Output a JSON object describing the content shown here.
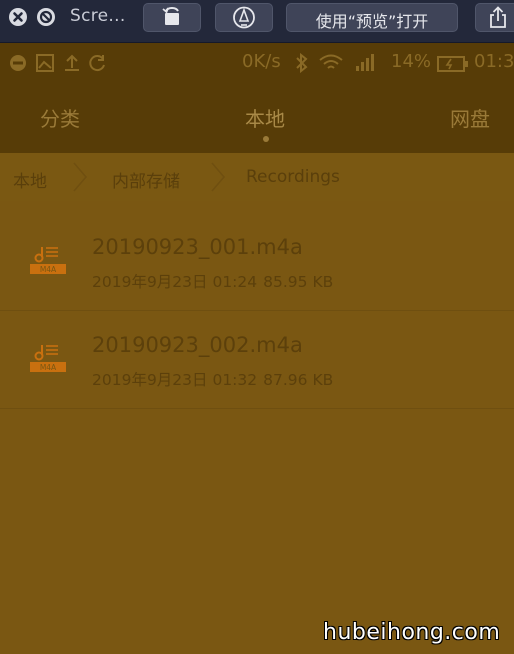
{
  "mac_toolbar": {
    "title": "Scre...",
    "open_with_preview": "使用“预览”打开"
  },
  "status_bar": {
    "speed": "0K/s",
    "battery": "14%",
    "time": "01:3"
  },
  "nav": {
    "tabs": [
      {
        "label": "分类"
      },
      {
        "label": "本地"
      },
      {
        "label": "网盘"
      }
    ],
    "active_tab": "本地"
  },
  "breadcrumb": [
    "本地",
    "内部存储",
    "Recordings"
  ],
  "files": [
    {
      "name": "20190923_001.m4a",
      "date": "2019年9月23日 01:24",
      "size": "85.95 KB",
      "badge": "M4A"
    },
    {
      "name": "20190923_002.m4a",
      "date": "2019年9月23日 01:32",
      "size": "87.96 KB",
      "badge": "M4A"
    }
  ],
  "watermark": "hubeihong.com",
  "colors": {
    "mac_toolbar": "#23283a",
    "app_header": "#573c07",
    "app_body": "#7a5712",
    "file_icon_accent": "#c9700f"
  }
}
